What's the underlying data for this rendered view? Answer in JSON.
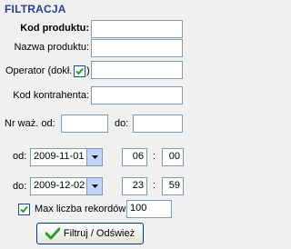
{
  "panel_title": "FILTRACJA",
  "labels": {
    "product_code": "Kod produktu:",
    "product_name": "Nazwa produktu:",
    "operator": "Operator (dokł.",
    "contractor_code": "Kod kontrahenta:",
    "weigh_no_from": "Nr waż. od:",
    "weigh_no_to": "do:",
    "date_from": "od:",
    "date_to": "do:",
    "time_sep": ":",
    "max_records": "Max liczba rekordów:"
  },
  "values": {
    "product_code": "",
    "product_name": "",
    "operator": "",
    "contractor_code": "",
    "weigh_no_from": "",
    "weigh_no_to": "",
    "date_from": "2009-11-01",
    "date_to": "2009-12-02",
    "hour_from": "06",
    "minute_from": "00",
    "hour_to": "23",
    "minute_to": "59",
    "max_records": "100"
  },
  "checkboxes": {
    "operator_exact_checked": true,
    "max_records_checked": true
  },
  "button": {
    "label": "Filtruj / Odśwież"
  },
  "icons": {
    "checkmark": "check-icon",
    "dropdown": "chevron-down-icon",
    "button_icon": "green-check-icon"
  },
  "colors": {
    "title": "#2a3f8f",
    "field_border": "#7f9db9",
    "button_icon": "#2e9b2e"
  }
}
